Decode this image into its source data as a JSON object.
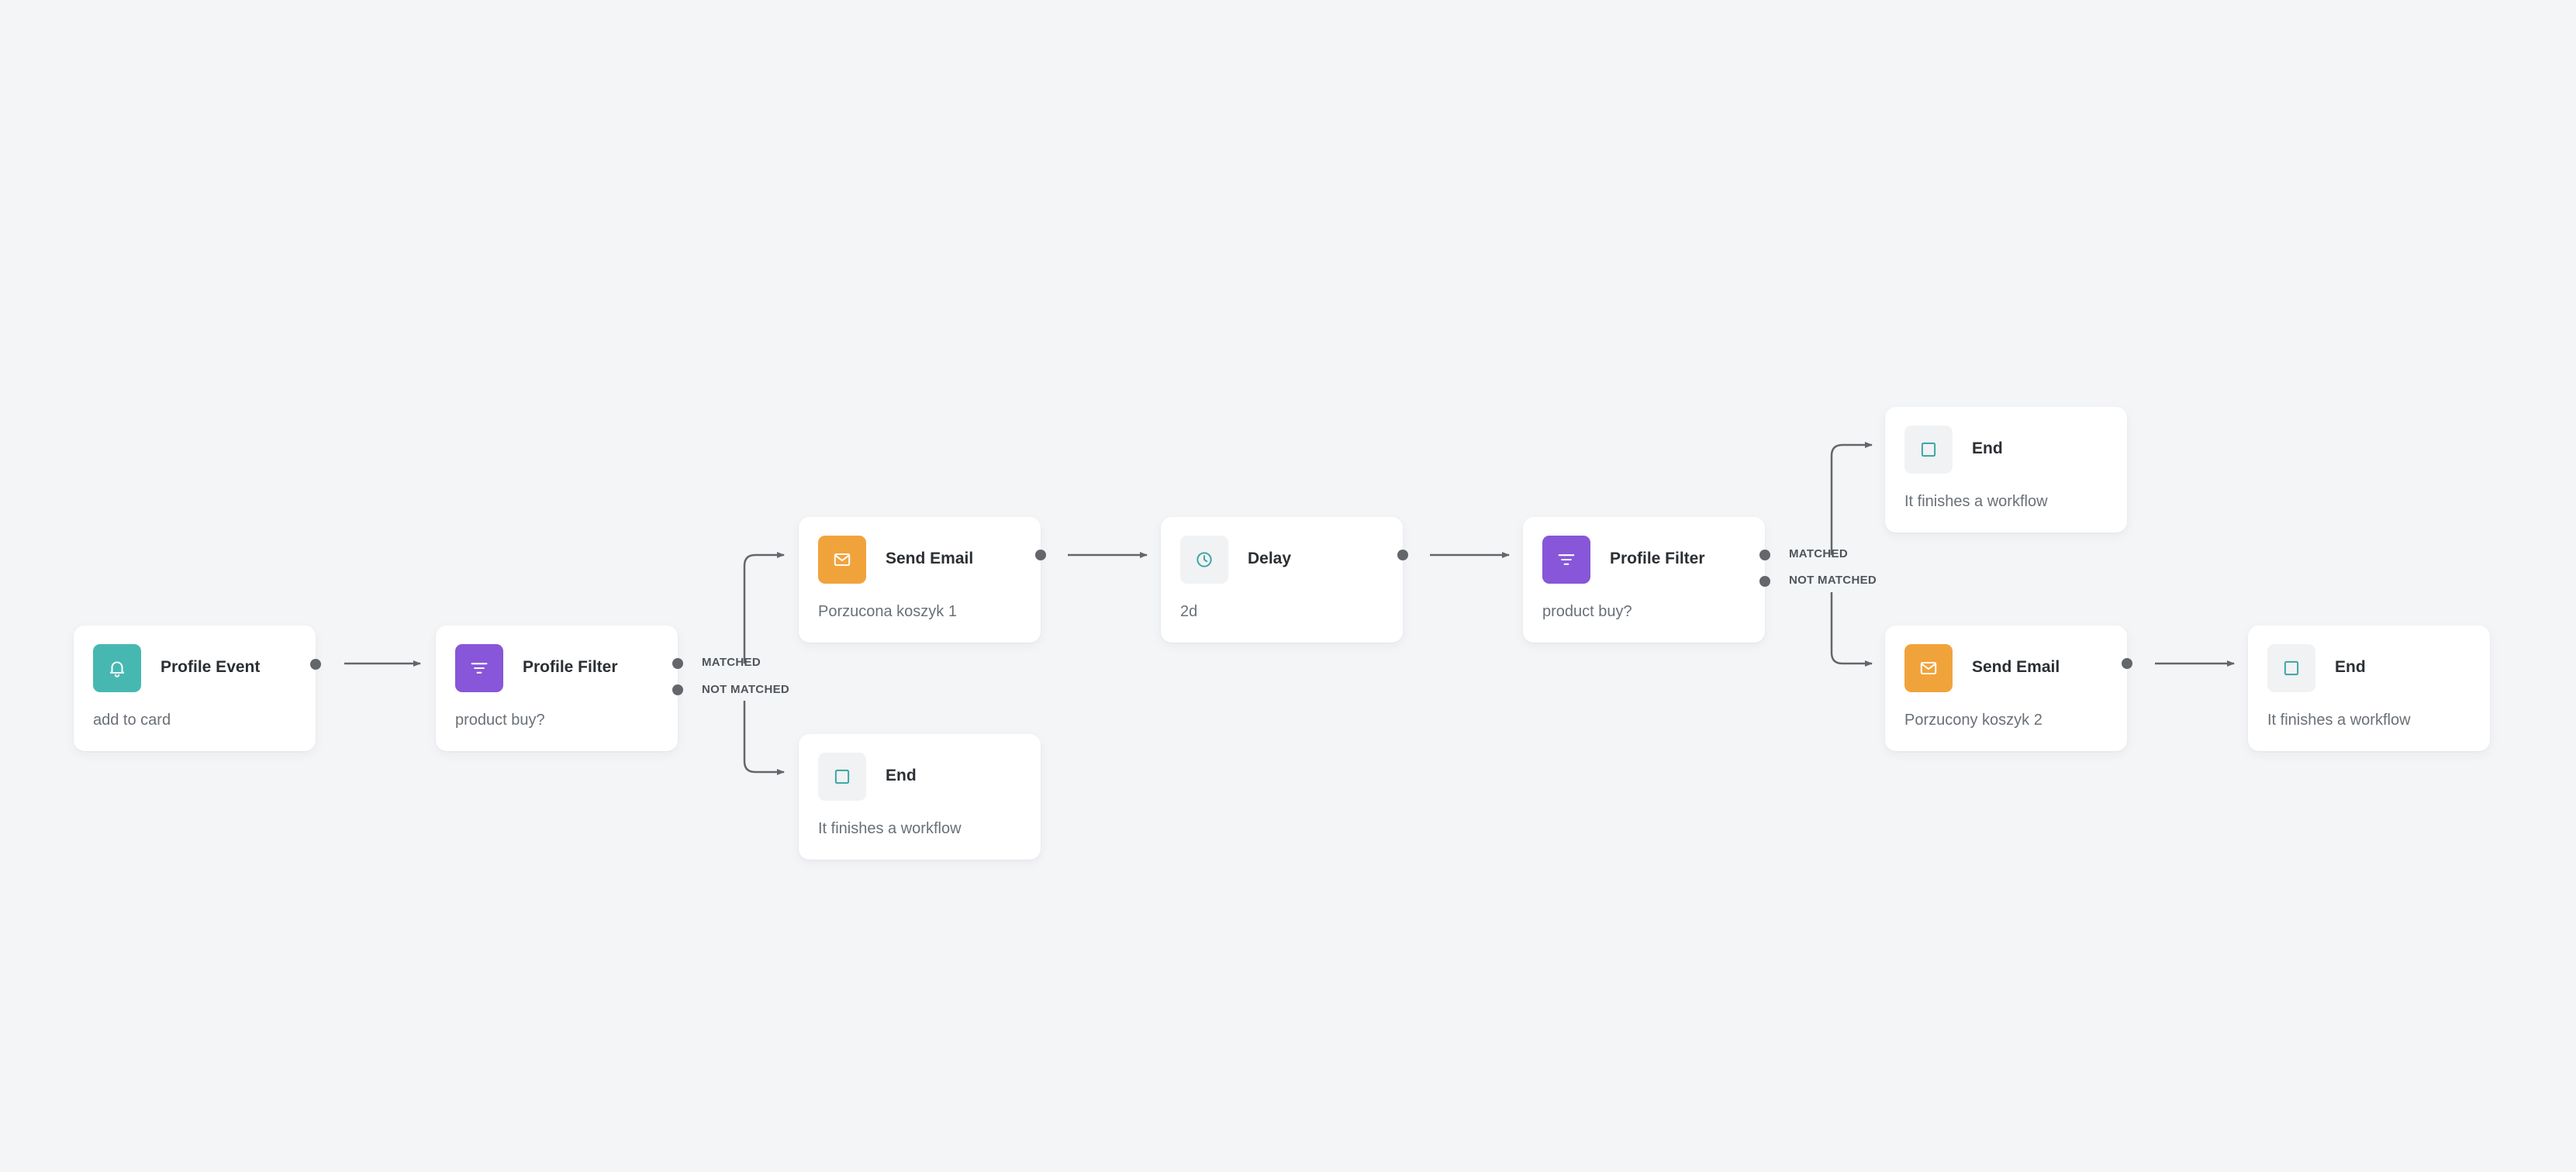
{
  "colors": {
    "canvas_background": "#f4f5f7",
    "node_background": "#ffffff",
    "connector": "#63676c",
    "event_accent": "#47b8b1",
    "filter_accent": "#8756d9",
    "email_accent": "#f1a33b",
    "end_accent": "#3aa5a1",
    "delay_accent": "#3aa5a1"
  },
  "nodes": {
    "profile_event": {
      "icon": "bell-icon",
      "title": "Profile Event",
      "subtitle": "add to card"
    },
    "profile_filter_1": {
      "icon": "filter-icon",
      "title": "Profile Filter",
      "subtitle": "product buy?",
      "matched_label": "MATCHED",
      "not_matched_label": "NOT MATCHED"
    },
    "send_email_1": {
      "icon": "mail-icon",
      "title": "Send Email",
      "subtitle": "Porzucona koszyk 1"
    },
    "end_1": {
      "icon": "square-icon",
      "title": "End",
      "subtitle": "It finishes a workflow"
    },
    "delay": {
      "icon": "clock-icon",
      "title": "Delay",
      "subtitle": "2d"
    },
    "profile_filter_2": {
      "icon": "filter-icon",
      "title": "Profile Filter",
      "subtitle": "product buy?",
      "matched_label": "MATCHED",
      "not_matched_label": "NOT MATCHED"
    },
    "end_2": {
      "icon": "square-icon",
      "title": "End",
      "subtitle": "It finishes a workflow"
    },
    "send_email_2": {
      "icon": "mail-icon",
      "title": "Send Email",
      "subtitle": "Porzucony koszyk 2"
    },
    "end_3": {
      "icon": "square-icon",
      "title": "End",
      "subtitle": "It finishes a workflow"
    }
  }
}
